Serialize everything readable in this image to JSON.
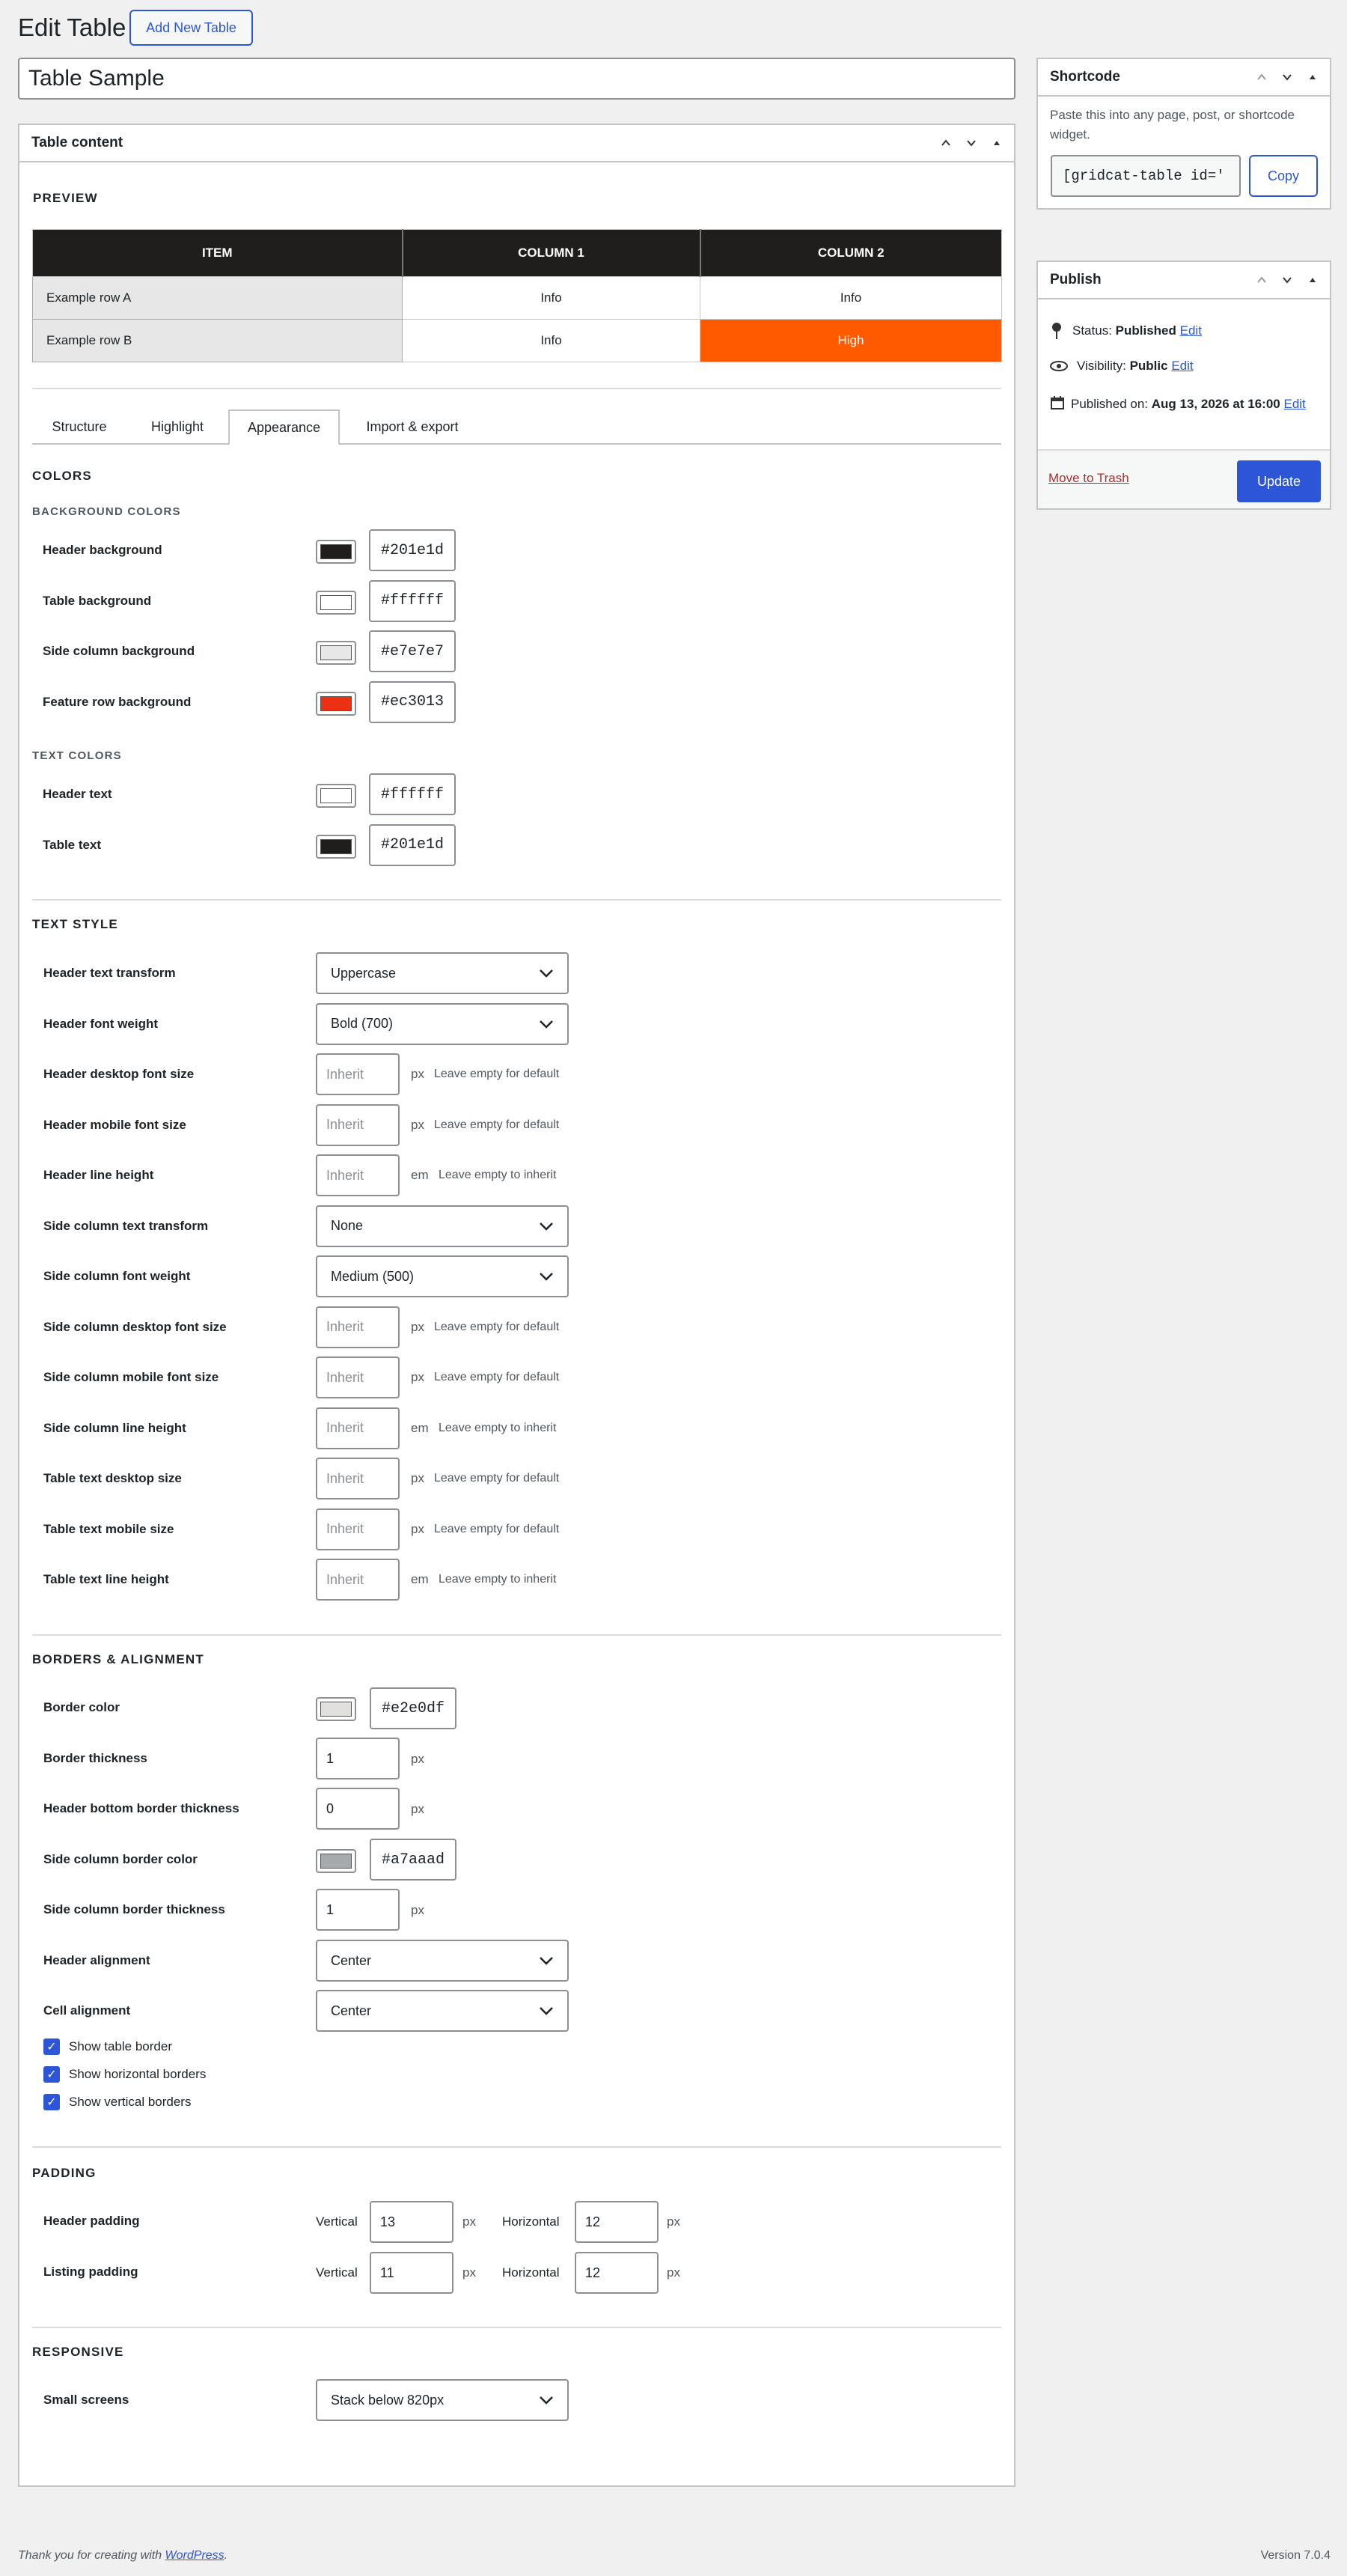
{
  "page": {
    "title": "Edit Table",
    "add_new_label": "Add New Table",
    "table_title": "Table Sample"
  },
  "content_box": {
    "title": "Table content",
    "preview_label": "PREVIEW"
  },
  "preview": {
    "headers": [
      "ITEM",
      "COLUMN 1",
      "COLUMN 2"
    ],
    "rows": [
      [
        "Example row A",
        "Info",
        "Info"
      ],
      [
        "Example row B",
        "Info",
        "High"
      ]
    ]
  },
  "tabs": [
    "Structure",
    "Highlight",
    "Appearance",
    "Import & export"
  ],
  "active_tab": "Appearance",
  "colors": {
    "title": "COLORS",
    "bg_title": "BACKGROUND COLORS",
    "bg": [
      {
        "label": "Header background",
        "value": "#201e1d",
        "swatch": "#201e1d"
      },
      {
        "label": "Table background",
        "value": "#ffffff",
        "swatch": "#ffffff"
      },
      {
        "label": "Side column background",
        "value": "#e7e7e7",
        "swatch": "#e7e7e7"
      },
      {
        "label": "Feature row background",
        "value": "#ec3013",
        "swatch": "#ec3013"
      }
    ],
    "text_title": "TEXT COLORS",
    "text": [
      {
        "label": "Header text",
        "value": "#ffffff",
        "swatch": "#ffffff"
      },
      {
        "label": "Table text",
        "value": "#201e1d",
        "swatch": "#201e1d"
      }
    ]
  },
  "text_style": {
    "title": "TEXT STYLE",
    "rows": [
      {
        "label": "Header text transform",
        "kind": "select",
        "value": "Uppercase"
      },
      {
        "label": "Header font weight",
        "kind": "select",
        "value": "Bold (700)"
      },
      {
        "label": "Header desktop font size",
        "kind": "num",
        "placeholder": "Inherit",
        "unit": "px",
        "hint": "Leave empty for default"
      },
      {
        "label": "Header mobile font size",
        "kind": "num",
        "placeholder": "Inherit",
        "unit": "px",
        "hint": "Leave empty for default"
      },
      {
        "label": "Header line height",
        "kind": "num",
        "placeholder": "Inherit",
        "unit": "em",
        "hint": "Leave empty to inherit"
      },
      {
        "label": "Side column text transform",
        "kind": "select",
        "value": "None"
      },
      {
        "label": "Side column font weight",
        "kind": "select",
        "value": "Medium (500)"
      },
      {
        "label": "Side column desktop font size",
        "kind": "num",
        "placeholder": "Inherit",
        "unit": "px",
        "hint": "Leave empty for default"
      },
      {
        "label": "Side column mobile font size",
        "kind": "num",
        "placeholder": "Inherit",
        "unit": "px",
        "hint": "Leave empty for default"
      },
      {
        "label": "Side column line height",
        "kind": "num",
        "placeholder": "Inherit",
        "unit": "em",
        "hint": "Leave empty to inherit"
      },
      {
        "label": "Table text desktop size",
        "kind": "num",
        "placeholder": "Inherit",
        "unit": "px",
        "hint": "Leave empty for default"
      },
      {
        "label": "Table text mobile size",
        "kind": "num",
        "placeholder": "Inherit",
        "unit": "px",
        "hint": "Leave empty for default"
      },
      {
        "label": "Table text line height",
        "kind": "num",
        "placeholder": "Inherit",
        "unit": "em",
        "hint": "Leave empty to inherit"
      }
    ]
  },
  "borders": {
    "title": "BORDERS & ALIGNMENT",
    "border_color": {
      "label": "Border color",
      "value": "#e2e0df",
      "swatch": "#e2e0df"
    },
    "border_thickness": {
      "label": "Border thickness",
      "value": "1",
      "unit": "px"
    },
    "header_bottom": {
      "label": "Header bottom border thickness",
      "value": "0",
      "unit": "px"
    },
    "side_color": {
      "label": "Side column border color",
      "value": "#a7aaad",
      "swatch": "#a7aaad"
    },
    "side_thickness": {
      "label": "Side column border thickness",
      "value": "1",
      "unit": "px"
    },
    "header_align": {
      "label": "Header alignment",
      "value": "Center"
    },
    "cell_align": {
      "label": "Cell alignment",
      "value": "Center"
    },
    "checkboxes": [
      "Show table border",
      "Show horizontal borders",
      "Show vertical borders"
    ]
  },
  "padding": {
    "title": "PADDING",
    "vertical_label": "Vertical",
    "horizontal_label": "Horizontal",
    "unit": "px",
    "header": {
      "label": "Header padding",
      "vertical": "13",
      "horizontal": "12"
    },
    "listing": {
      "label": "Listing padding",
      "vertical": "11",
      "horizontal": "12"
    }
  },
  "responsive": {
    "title": "RESPONSIVE",
    "label": "Small screens",
    "value": "Stack below 820px"
  },
  "shortcode": {
    "title": "Shortcode",
    "desc": "Paste this into any page, post, or shortcode widget.",
    "value": "[gridcat-table id='",
    "copy_label": "Copy"
  },
  "publish": {
    "title": "Publish",
    "status_label": "Status:",
    "status_value": "Published",
    "visibility_label": "Visibility:",
    "visibility_value": "Public",
    "published_label": "Published on:",
    "published_value": "Aug 13, 2026 at 16:00",
    "edit_label": "Edit",
    "trash_label": "Move to Trash",
    "update_label": "Update"
  },
  "footer": {
    "thanks_prefix": "Thank you for creating with ",
    "wp_link": "WordPress",
    "thanks_suffix": ".",
    "version": "Version 7.0.4"
  },
  "colors_meta": {
    "accent": "#2c55d8",
    "header_bg": "#201e1d",
    "high_bg": "#ff5a00",
    "side_bg": "#e7e7e7"
  }
}
